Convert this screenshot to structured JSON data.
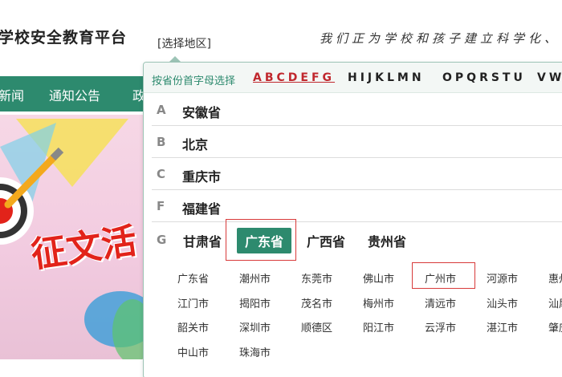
{
  "header": {
    "site_title": "学校安全教育平台",
    "region_trigger": "[选择地区]",
    "slogan": "我们正为学校和孩子建立科学化、常"
  },
  "nav": {
    "items": [
      "新闻",
      "通知公告",
      "政"
    ]
  },
  "banner": {
    "text": "征文活"
  },
  "region_panel": {
    "hint": "按省份首字母选择",
    "letter_groups": [
      "ABCDEFG",
      "HIJKLMN",
      "OPQRSTU",
      "VWXYZ"
    ],
    "active_letter_group": "ABCDEFG",
    "rows": [
      {
        "letter": "A",
        "provinces": [
          "安徽省"
        ]
      },
      {
        "letter": "B",
        "provinces": [
          "北京"
        ]
      },
      {
        "letter": "C",
        "provinces": [
          "重庆市"
        ]
      },
      {
        "letter": "F",
        "provinces": [
          "福建省"
        ]
      }
    ],
    "g_row": {
      "letter": "G",
      "provinces": [
        "甘肃省",
        "广东省",
        "广西省",
        "贵州省"
      ],
      "selected_province": "广东省"
    },
    "cities": [
      [
        "广东省",
        "潮州市",
        "东莞市",
        "佛山市",
        "广州市",
        "河源市",
        "惠州市"
      ],
      [
        "江门市",
        "揭阳市",
        "茂名市",
        "梅州市",
        "清远市",
        "汕头市",
        "汕尾市"
      ],
      [
        "韶关市",
        "深圳市",
        "顺德区",
        "阳江市",
        "云浮市",
        "湛江市",
        "肇庆市"
      ],
      [
        "中山市",
        "珠海市"
      ]
    ],
    "highlighted_city": "广州市"
  },
  "colors": {
    "brand_green": "#2d8a6e",
    "active_letter": "#c0272d",
    "highlight_box": "#d83a3a"
  }
}
